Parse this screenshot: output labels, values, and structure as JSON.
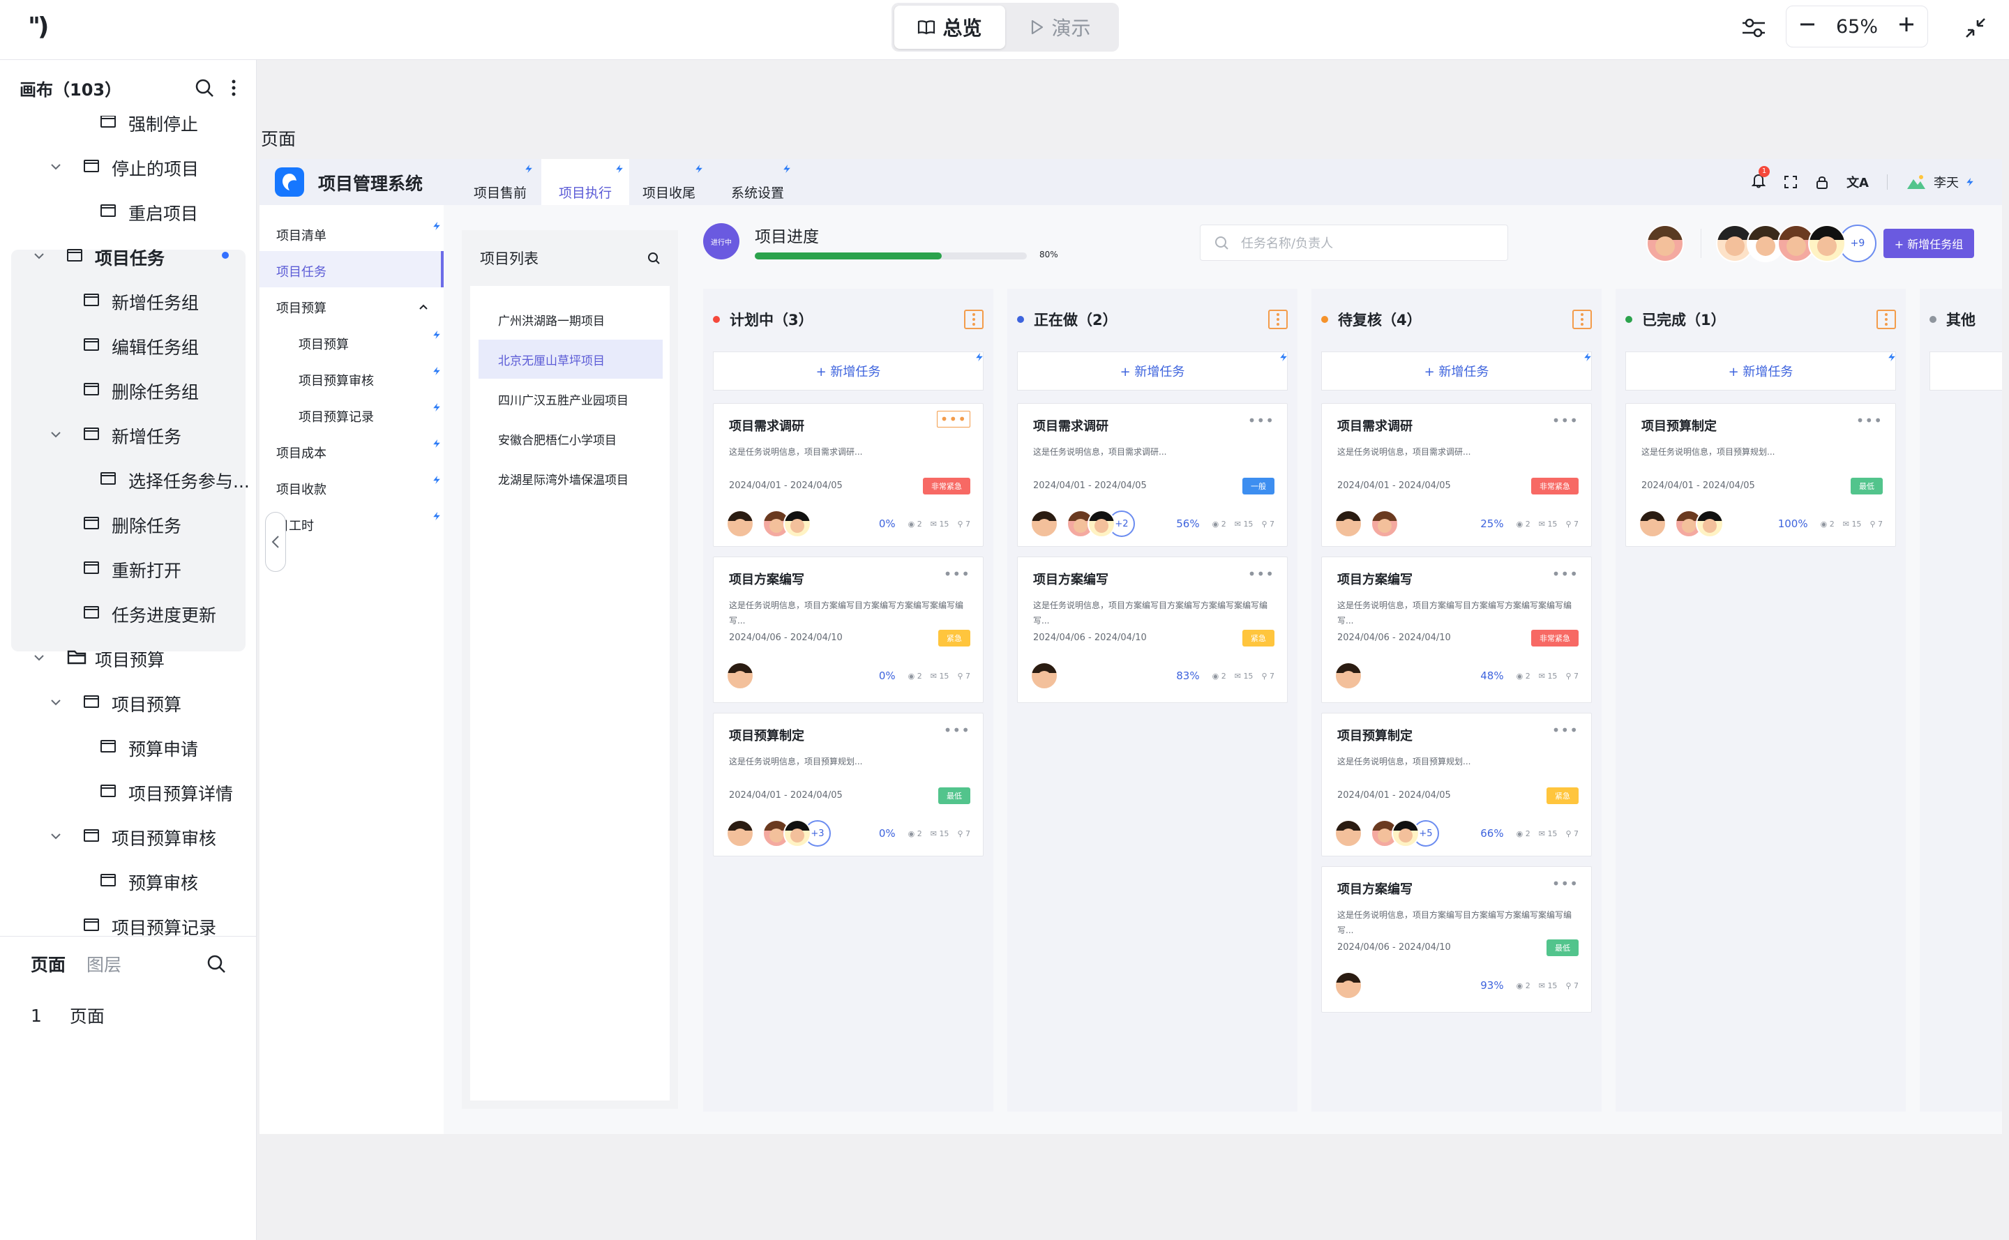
{
  "topbar": {
    "logo": "'')",
    "modes": [
      {
        "label": "总览",
        "active": true
      },
      {
        "label": "演示",
        "active": false
      }
    ],
    "zoom": "65%"
  },
  "left_panel": {
    "title": "画布（103）",
    "tree": [
      {
        "label": "强制停止",
        "level": 3,
        "type": "page",
        "caret": ""
      },
      {
        "label": "停止的项目",
        "level": 2,
        "type": "page",
        "caret": "v"
      },
      {
        "label": "重启项目",
        "level": 3,
        "type": "page",
        "caret": ""
      },
      {
        "label": "项目任务",
        "level": 1,
        "type": "page",
        "caret": "v",
        "selected": true
      },
      {
        "label": "新增任务组",
        "level": 2,
        "type": "page",
        "caret": ""
      },
      {
        "label": "编辑任务组",
        "level": 2,
        "type": "page",
        "caret": ""
      },
      {
        "label": "删除任务组",
        "level": 2,
        "type": "page",
        "caret": ""
      },
      {
        "label": "新增任务",
        "level": 2,
        "type": "page",
        "caret": "v"
      },
      {
        "label": "选择任务参与...",
        "level": 3,
        "type": "page",
        "caret": ""
      },
      {
        "label": "删除任务",
        "level": 2,
        "type": "page",
        "caret": ""
      },
      {
        "label": "重新打开",
        "level": 2,
        "type": "page",
        "caret": ""
      },
      {
        "label": "任务进度更新",
        "level": 2,
        "type": "page",
        "caret": ""
      },
      {
        "label": "项目预算",
        "level": 1,
        "type": "folder",
        "caret": "v"
      },
      {
        "label": "项目预算",
        "level": 2,
        "type": "page",
        "caret": "v"
      },
      {
        "label": "预算申请",
        "level": 3,
        "type": "page",
        "caret": ""
      },
      {
        "label": "项目预算详情",
        "level": 3,
        "type": "page",
        "caret": ""
      },
      {
        "label": "项目预算审核",
        "level": 2,
        "type": "page",
        "caret": "v"
      },
      {
        "label": "预算审核",
        "level": 3,
        "type": "page",
        "caret": ""
      },
      {
        "label": "项目预算记录",
        "level": 2,
        "type": "page",
        "caret": ""
      }
    ],
    "bottom_tabs": [
      {
        "label": "页面",
        "active": true
      },
      {
        "label": "图层",
        "active": false
      }
    ],
    "pages": [
      {
        "index": "1",
        "name": "页面"
      }
    ]
  },
  "canvas_label": "页面",
  "app": {
    "title": "项目管理系统",
    "tabs": [
      {
        "label": "项目售前",
        "active": false
      },
      {
        "label": "项目执行",
        "active": true
      },
      {
        "label": "项目收尾",
        "active": false
      },
      {
        "label": "系统设置",
        "active": false
      }
    ],
    "notification_count": "1",
    "user": "李天",
    "submenu": [
      {
        "label": "项目清单",
        "sub": false,
        "selected": false
      },
      {
        "label": "项目任务",
        "sub": false,
        "selected": true
      },
      {
        "label": "项目预算",
        "sub": false,
        "selected": false
      },
      {
        "label": "项目预算",
        "sub": true,
        "selected": false
      },
      {
        "label": "项目预算审核",
        "sub": true,
        "selected": false
      },
      {
        "label": "项目预算记录",
        "sub": true,
        "selected": false
      },
      {
        "label": "项目成本",
        "sub": false,
        "selected": false
      },
      {
        "label": "项目收款",
        "sub": false,
        "selected": false
      },
      {
        "label": "目工时",
        "sub": false,
        "selected": false
      }
    ],
    "project_list": {
      "title": "项目列表",
      "items": [
        {
          "label": "广州洪湖路一期项目",
          "selected": false
        },
        {
          "label": "北京无厘山草坪项目",
          "selected": true
        },
        {
          "label": "四川广汉五胜产业园项目",
          "selected": false
        },
        {
          "label": "安徽合肥梧仁小学项目",
          "selected": false
        },
        {
          "label": "龙湖星际湾外墙保温项目",
          "selected": false
        }
      ]
    },
    "progress": {
      "badge": "进行中",
      "title": "项目进度",
      "value": 0.8,
      "label": "80%"
    },
    "search_placeholder": "任务名称/负责人",
    "more_members": "+9",
    "add_group_button": "+ 新增任务组",
    "add_task_label": "+ 新增任务",
    "columns": [
      {
        "title": "计划中（3）",
        "color": "#f5483b",
        "cards": [
          {
            "title": "项目需求调研",
            "desc": "这是任务说明信息，项目需求调研...",
            "date": "2024/04/01 - 2024/04/05",
            "tag": "非常紧急",
            "tag_color": "#f76964",
            "pct": "0%",
            "views": "2",
            "comments": "15",
            "links": "7",
            "avatars": 3,
            "more": "",
            "dots_boxed": true
          },
          {
            "title": "项目方案编写",
            "desc": "这是任务说明信息，项目方案编写目方案编写方案编写案编写编写...",
            "date": "2024/04/06 - 2024/04/10",
            "tag": "紧急",
            "tag_color": "#ffc53d",
            "pct": "0%",
            "views": "2",
            "comments": "15",
            "links": "7",
            "avatars": 1,
            "more": "",
            "dots_boxed": false
          },
          {
            "title": "项目预算制定",
            "desc": "这是任务说明信息，项目预算规划...",
            "date": "2024/04/01 - 2024/04/05",
            "tag": "最低",
            "tag_color": "#52c48c",
            "pct": "0%",
            "views": "2",
            "comments": "15",
            "links": "7",
            "avatars": 3,
            "more": "+3",
            "dots_boxed": false
          }
        ]
      },
      {
        "title": "正在做（2）",
        "color": "#3d63dd",
        "cards": [
          {
            "title": "项目需求调研",
            "desc": "这是任务说明信息，项目需求调研...",
            "date": "2024/04/01 - 2024/04/05",
            "tag": "一般",
            "tag_color": "#3d8ef0",
            "pct": "56%",
            "views": "2",
            "comments": "15",
            "links": "7",
            "avatars": 3,
            "more": "+2",
            "dots_boxed": false
          },
          {
            "title": "项目方案编写",
            "desc": "这是任务说明信息，项目方案编写目方案编写方案编写案编写编写...",
            "date": "2024/04/06 - 2024/04/10",
            "tag": "紧急",
            "tag_color": "#ffc53d",
            "pct": "83%",
            "views": "2",
            "comments": "15",
            "links": "7",
            "avatars": 1,
            "more": "",
            "dots_boxed": false
          }
        ]
      },
      {
        "title": "待复核（4）",
        "color": "#f5922b",
        "cards": [
          {
            "title": "项目需求调研",
            "desc": "这是任务说明信息，项目需求调研...",
            "date": "2024/04/01 - 2024/04/05",
            "tag": "非常紧急",
            "tag_color": "#f76964",
            "pct": "25%",
            "views": "2",
            "comments": "15",
            "links": "7",
            "avatars": 2,
            "more": "",
            "dots_boxed": false
          },
          {
            "title": "项目方案编写",
            "desc": "这是任务说明信息，项目方案编写目方案编写方案编写案编写编写...",
            "date": "2024/04/06 - 2024/04/10",
            "tag": "非常紧急",
            "tag_color": "#f76964",
            "pct": "48%",
            "views": "2",
            "comments": "15",
            "links": "7",
            "avatars": 1,
            "more": "",
            "dots_boxed": false
          },
          {
            "title": "项目预算制定",
            "desc": "这是任务说明信息，项目预算规划...",
            "date": "2024/04/01 - 2024/04/05",
            "tag": "紧急",
            "tag_color": "#ffc53d",
            "pct": "66%",
            "views": "2",
            "comments": "15",
            "links": "7",
            "avatars": 3,
            "more": "+5",
            "dots_boxed": false
          },
          {
            "title": "项目方案编写",
            "desc": "这是任务说明信息，项目方案编写目方案编写方案编写案编写编写...",
            "date": "2024/04/06 - 2024/04/10",
            "tag": "最低",
            "tag_color": "#52c48c",
            "pct": "93%",
            "views": "2",
            "comments": "15",
            "links": "7",
            "avatars": 1,
            "more": "",
            "dots_boxed": false
          }
        ]
      },
      {
        "title": "已完成（1）",
        "color": "#2ba24c",
        "cards": [
          {
            "title": "项目预算制定",
            "desc": "这是任务说明信息，项目预算规划...",
            "date": "2024/04/01 - 2024/04/05",
            "tag": "最低",
            "tag_color": "#52c48c",
            "pct": "100%",
            "views": "2",
            "comments": "15",
            "links": "7",
            "avatars": 3,
            "more": "",
            "dots_boxed": false
          }
        ]
      },
      {
        "title": "其他",
        "color": "#8f959e",
        "cards": []
      }
    ]
  }
}
